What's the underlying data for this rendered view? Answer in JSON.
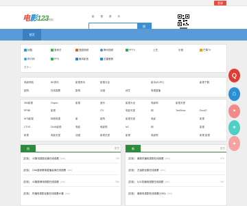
{
  "topbar": {
    "login_label": "登录"
  },
  "header": {
    "logo_part1": "电",
    "logo_part2": "影",
    "logo_part3": "123",
    "logo_sub": "网址导航",
    "search_tabs": [
      "影",
      "视",
      "音",
      "乐"
    ],
    "search_placeholder": "",
    "search_button": "搜"
  },
  "nav": {
    "home_label": "首页"
  },
  "quicklinks": [
    {
      "label": "优酷",
      "color": "#1e9be3"
    },
    {
      "label": "爱奇艺",
      "color": "#3cba3c"
    },
    {
      "label": "搜狐视频",
      "color": "#e85c2c"
    },
    {
      "label": "腾讯视频",
      "color": "#3b8ee0"
    },
    {
      "label": "PPTV",
      "color": "#2faa51"
    },
    {
      "label": "土豆",
      "color": "#ff6600"
    },
    {
      "label": "乐视",
      "color": "#e8372f"
    },
    {
      "label": "芒果TV",
      "color": "#ff9900"
    },
    {
      "label": "风行网",
      "color": "#2aa6e8"
    },
    {
      "label": "PPS",
      "color": "#2fb54b"
    },
    {
      "label": "暴风影音",
      "color": "#2b7ee6"
    },
    {
      "label": "迅雷看看",
      "color": "#1f8ed6"
    },
    {
      "label": "更多>>",
      "color": "#999999"
    }
  ],
  "panel2": [
    "电影网站",
    "BE资讯",
    "影视资讯",
    "影视大全",
    "影评(ACPE)",
    "影视下载",
    "影院",
    "在线观看",
    "剧场",
    "动漫",
    "综艺",
    "电视直播"
  ],
  "panel3": [
    "360影视",
    "Goyoo",
    "影视",
    "音乐",
    "影视大全",
    "电影网",
    "影视天堂",
    "RPIBI",
    "影视",
    "ITV",
    "电影天堂",
    "网",
    "TaoShow",
    "Doo42",
    "M78影视",
    "网络电视",
    "影",
    "影院",
    "影视天堂",
    "电影",
    "影视",
    "CTVS",
    "DIAN影视",
    "电影",
    "电影院",
    "le2",
    "网",
    "影视",
    "影视",
    "电影天堂",
    "动漫",
    "影视天堂",
    "影视",
    "电影院",
    "影视 影视"
  ],
  "section_left": {
    "tab": "热",
    "more": "更多",
    "rows": [
      {
        "tag": "[剧集]",
        "title": "42集电视剧全集在线观看",
        "count": "(4m)",
        "num": "796"
      },
      {
        "tag": "[剧集]",
        "title": "CBA篮球赛事直播高清在线观看",
        "count": "(4m)",
        "num": ""
      },
      {
        "tag": "[剧集]",
        "title": "42集剧情电视剧在线观看",
        "count": "(4m)",
        "num": "396"
      },
      {
        "tag": "[剧集]",
        "title": "热播电视剧全集在线观看40集",
        "count": "(4m)",
        "num": ""
      }
    ]
  },
  "section_right": {
    "tab": "新",
    "more": "更多",
    "rows": [
      {
        "tag": "[剧集]",
        "title": "最新热播电视剧在线观看",
        "count": "(4m)",
        "num": "376"
      },
      {
        "tag": "[剧集]",
        "title": "古装剧全集在线观看",
        "count": "(4m)",
        "num": ""
      },
      {
        "tag": "[剧集]",
        "title": "IL01热播电视剧在线观看",
        "count": "(4m)",
        "num": "197"
      },
      {
        "tag": "[剧集]",
        "title": "最新电视剧在线观看(1000)",
        "count": "(4m)",
        "num": ""
      }
    ]
  },
  "floats": [
    {
      "name": "search-float-icon",
      "color": "#e23b33",
      "glyph": "Q"
    },
    {
      "name": "home-float-icon",
      "color": "#2b8fd6",
      "glyph": "⌂"
    },
    {
      "name": "pink-float-icon",
      "color": "#f28a8a",
      "glyph": "♥"
    },
    {
      "name": "cyan-float-icon",
      "color": "#4fd0c6",
      "glyph": "★"
    },
    {
      "name": "peach-float-icon",
      "color": "#f7a2a2",
      "glyph": "▲"
    }
  ]
}
